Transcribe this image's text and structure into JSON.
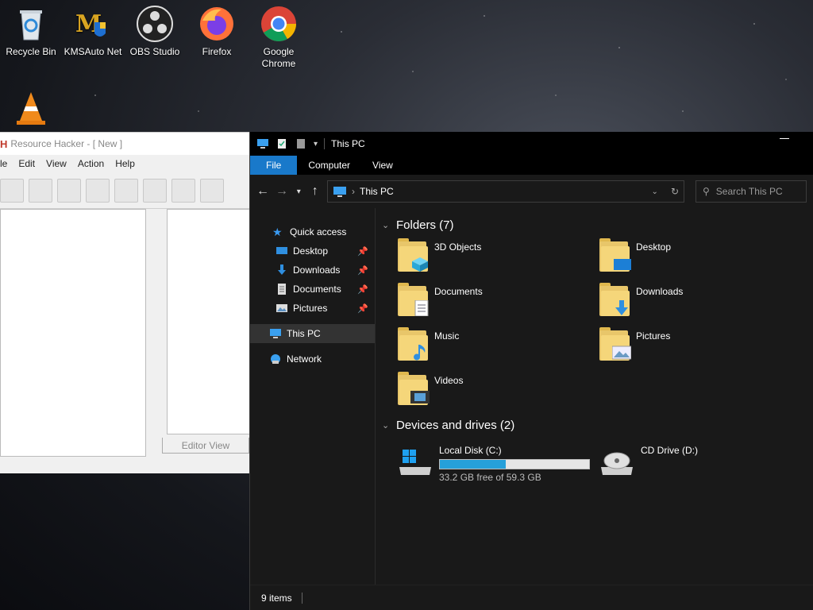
{
  "desktop": {
    "icons": [
      {
        "label": "Recycle Bin",
        "icon": "recycle-bin-icon"
      },
      {
        "label": "KMSAuto Net",
        "icon": "kmsauto-icon"
      },
      {
        "label": "OBS Studio",
        "icon": "obs-icon"
      },
      {
        "label": "Firefox",
        "icon": "firefox-icon"
      },
      {
        "label": "Google Chrome",
        "icon": "chrome-icon"
      },
      {
        "label": "",
        "icon": "vlc-icon"
      }
    ]
  },
  "resource_hacker": {
    "title": "Resource Hacker - [ New ]",
    "logo": "H",
    "menu": [
      "le",
      "Edit",
      "View",
      "Action",
      "Help"
    ],
    "tab_label": "Editor View"
  },
  "explorer": {
    "title": "This PC",
    "ribbon_tabs": [
      "File",
      "Computer",
      "View"
    ],
    "address_path": "This PC",
    "search_placeholder": "Search This PC",
    "nav": {
      "quick_access": "Quick access",
      "pinned": [
        "Desktop",
        "Downloads",
        "Documents",
        "Pictures"
      ],
      "this_pc": "This PC",
      "network": "Network"
    },
    "folders_header": "Folders (7)",
    "folders": [
      "3D Objects",
      "Desktop",
      "Documents",
      "Downloads",
      "Music",
      "Pictures",
      "Videos"
    ],
    "drives_header": "Devices and drives (2)",
    "drives": [
      {
        "name": "Local Disk (C:)",
        "free": "33.2 GB free of 59.3 GB",
        "used_fraction": 0.44
      },
      {
        "name": "CD Drive (D:)"
      }
    ],
    "status_items": "9 items",
    "colors": {
      "accent": "#1979ca",
      "bar_fill": "#26a0da",
      "folder": "#f5d67a"
    }
  }
}
